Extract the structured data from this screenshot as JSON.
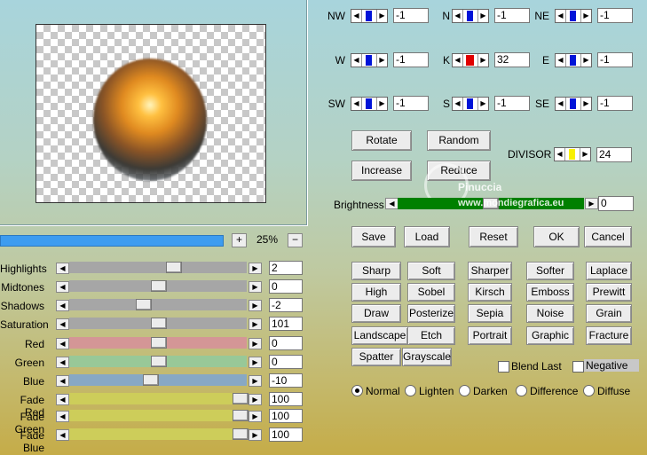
{
  "preview": {
    "zoom": "25%",
    "zoom_in": "+",
    "zoom_out": "−"
  },
  "sliders": [
    {
      "label": "Highlights",
      "value": "2",
      "level": 0.59,
      "track_color": "#a6a6a6"
    },
    {
      "label": "Midtones",
      "value": "0",
      "level": 0.5,
      "track_color": "#a6a6a6"
    },
    {
      "label": "Shadows",
      "value": "-2",
      "level": 0.41,
      "track_color": "#a6a6a6"
    },
    {
      "label": "Saturation",
      "value": "101",
      "level": 0.5,
      "track_color": "#a6a6a6"
    },
    {
      "label": "Red",
      "value": "0",
      "level": 0.5,
      "track_color": "#d49696"
    },
    {
      "label": "Green",
      "value": "0",
      "level": 0.5,
      "track_color": "#98c898"
    },
    {
      "label": "Blue",
      "value": "-10",
      "level": 0.45,
      "track_color": "#88a8c4"
    },
    {
      "label": "Fade Red",
      "value": "100",
      "level": 1.0,
      "track_color": "#cdcd5a"
    },
    {
      "label": "Fade Green",
      "value": "100",
      "level": 1.0,
      "track_color": "#cdcd5a"
    },
    {
      "label": "Fade Blue",
      "value": "100",
      "level": 1.0,
      "track_color": "#cdcd5a"
    }
  ],
  "kernel": [
    {
      "label": "NW",
      "value": "-1"
    },
    {
      "label": "N",
      "value": "-1"
    },
    {
      "label": "NE",
      "value": "-1"
    },
    {
      "label": "W",
      "value": "-1"
    },
    {
      "label": "K",
      "value": "32"
    },
    {
      "label": "E",
      "value": "-1"
    },
    {
      "label": "SW",
      "value": "-1"
    },
    {
      "label": "S",
      "value": "-1"
    },
    {
      "label": "SE",
      "value": "-1"
    }
  ],
  "buttons": {
    "rotate": "Rotate",
    "random": "Random",
    "increase": "Increase",
    "reduce": "Reduce",
    "save": "Save",
    "load": "Load",
    "reset": "Reset",
    "ok": "OK",
    "cancel": "Cancel"
  },
  "divisor": {
    "label": "DIVISOR",
    "value": "24"
  },
  "brightness": {
    "label": "Brightness",
    "value": "0"
  },
  "watermark": {
    "line1": "Pinuccia",
    "line2": "www.mondiegrafica.eu"
  },
  "filters": [
    [
      "Sharp",
      "Soft",
      "Sharper",
      "Softer",
      "Laplace"
    ],
    [
      "High Pass",
      "Sobel",
      "Kirsch",
      "Emboss",
      "Prewitt"
    ],
    [
      "Draw",
      "Posterize",
      "Sepia",
      "Noise",
      "Grain"
    ],
    [
      "Landscape",
      "Etch",
      "Portrait",
      "Graphic",
      "Fracture"
    ],
    [
      "Spatter",
      "Grayscale"
    ]
  ],
  "options": {
    "blend_last": "Blend Last",
    "negative": "Negative"
  },
  "modes": [
    "Normal",
    "Lighten",
    "Darken",
    "Difference",
    "Diffuse"
  ],
  "colors": {
    "spin_marker": "#0014d8",
    "center_marker": "#e00000",
    "divisor_marker": "#f8f000",
    "brightness_bar": "#008000",
    "progress": "#3d9cf0"
  }
}
